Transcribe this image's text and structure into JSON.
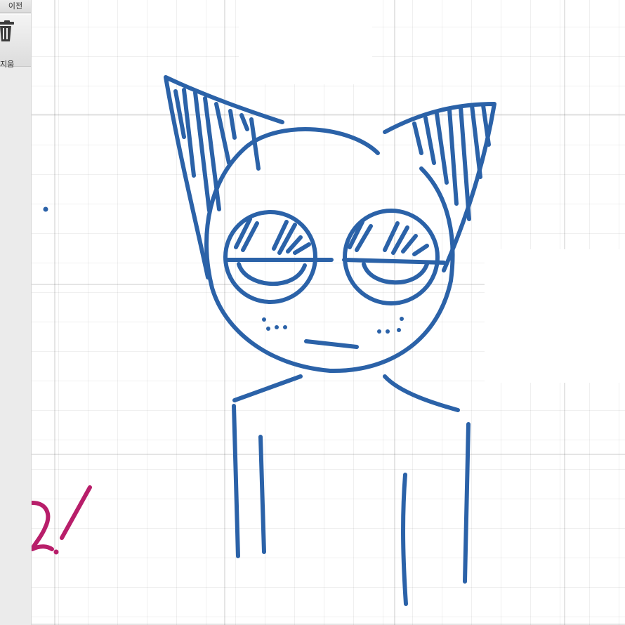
{
  "toolbar": {
    "prev_label": "이전",
    "delete_label": "지움"
  },
  "colors": {
    "ink_blue": "#2b62a8",
    "ink_magenta": "#b81e6a",
    "toolbar_bg": "#ebebeb",
    "grid_line": "#e3e3e3"
  },
  "icons": {
    "delete": "trash-icon"
  }
}
